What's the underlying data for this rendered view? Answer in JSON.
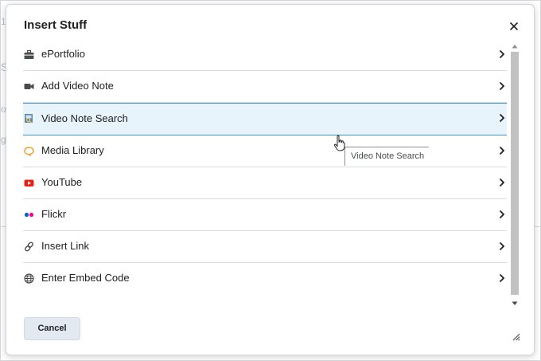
{
  "background": {
    "left_glyphs": [
      "1",
      "S",
      "o",
      "g"
    ]
  },
  "dialog": {
    "title": "Insert Stuff",
    "close_icon": "close-icon",
    "items": [
      {
        "label": "ePortfolio",
        "icon": "briefcase-icon",
        "selected": false
      },
      {
        "label": "Add Video Note",
        "icon": "video-camera-icon",
        "selected": false
      },
      {
        "label": "Video Note Search",
        "icon": "video-note-search-icon",
        "selected": true
      },
      {
        "label": "Media Library",
        "icon": "media-library-icon",
        "selected": false
      },
      {
        "label": "YouTube",
        "icon": "youtube-icon",
        "selected": false
      },
      {
        "label": "Flickr",
        "icon": "flickr-icon",
        "selected": false
      },
      {
        "label": "Insert Link",
        "icon": "link-icon",
        "selected": false
      },
      {
        "label": "Enter Embed Code",
        "icon": "globe-icon",
        "selected": false
      }
    ],
    "tooltip": "Video Note Search",
    "cancel_label": "Cancel"
  },
  "colors": {
    "selected_bg": "#e8f4fb",
    "selected_border": "#4a90c2",
    "youtube": "#e62117",
    "flickr_blue": "#0063dc",
    "flickr_pink": "#ff0084",
    "media_library": "#f0a030"
  }
}
